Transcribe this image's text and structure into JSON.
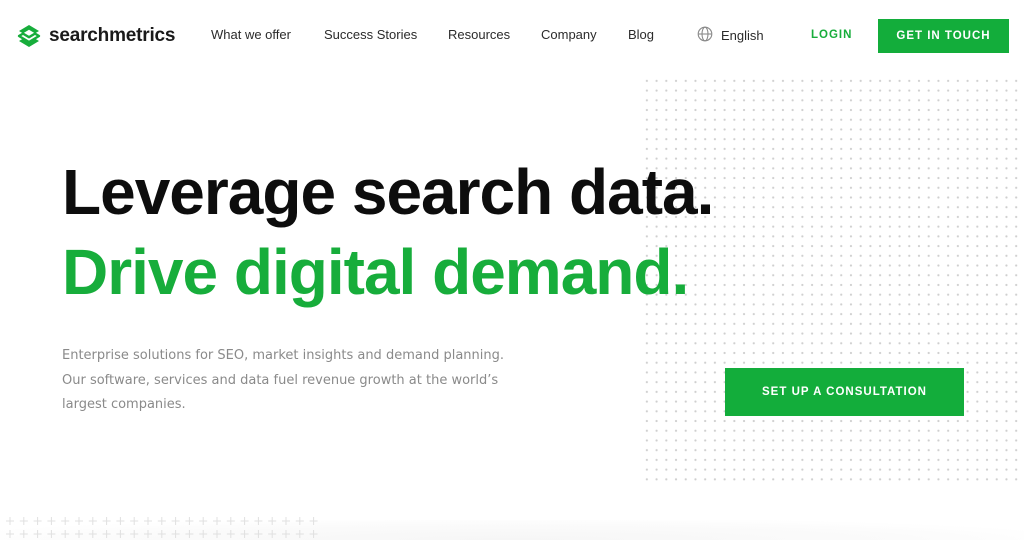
{
  "brand": {
    "name": "searchmetrics",
    "logo_icon": "stacked-layers-s-icon",
    "accent_color": "#13ad3b",
    "text_color": "#0d0d0d",
    "muted_color": "#8a8a8a"
  },
  "nav": {
    "items": [
      {
        "label": "What we offer"
      },
      {
        "label": "Success Stories"
      },
      {
        "label": "Resources"
      },
      {
        "label": "Company"
      },
      {
        "label": "Blog"
      }
    ],
    "language": {
      "icon": "globe-icon",
      "label": "English"
    },
    "login_label": "LOGIN",
    "cta_label": "GET IN TOUCH"
  },
  "hero": {
    "headline_line1": "Leverage search data.",
    "headline_line2": "Drive digital demand.",
    "description": "Enterprise solutions for SEO, market insights and demand planning. Our software, services and data fuel revenue growth at the world’s largest companies.",
    "cta_label": "SET UP A CONSULTATION"
  }
}
